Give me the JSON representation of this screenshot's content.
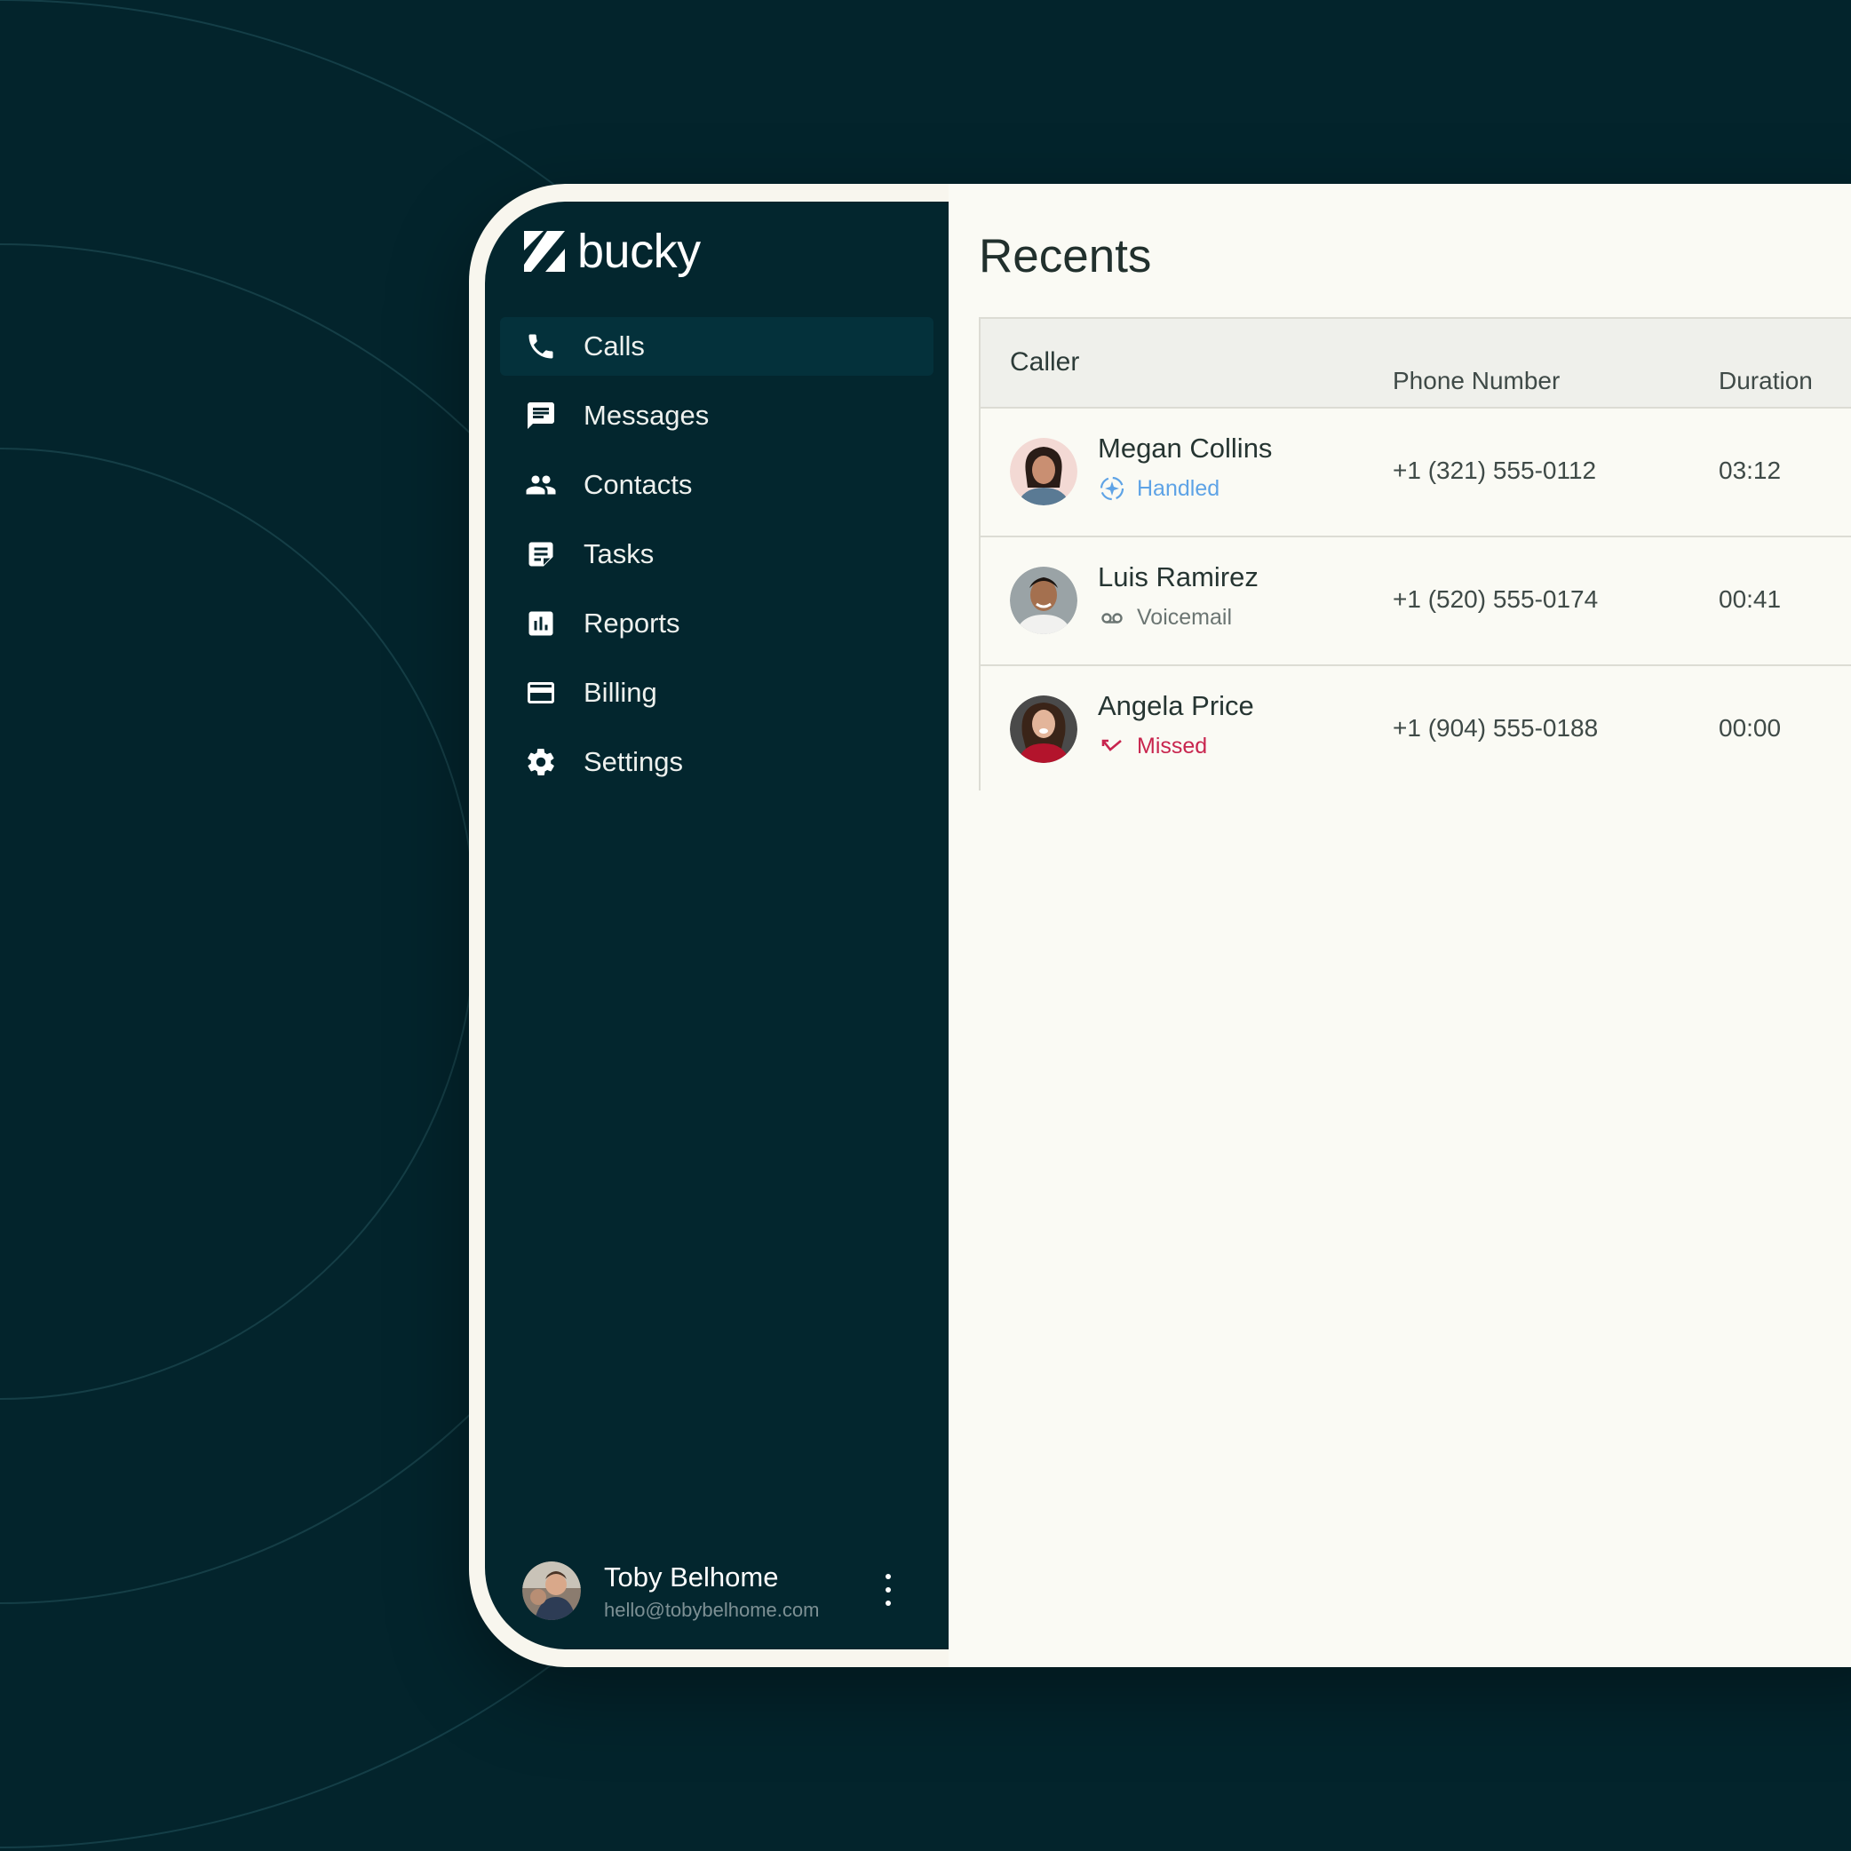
{
  "brand": {
    "name": "bucky"
  },
  "nav": {
    "items": [
      {
        "label": "Calls",
        "icon": "phone-icon",
        "active": true
      },
      {
        "label": "Messages",
        "icon": "message-icon",
        "active": false
      },
      {
        "label": "Contacts",
        "icon": "people-icon",
        "active": false
      },
      {
        "label": "Tasks",
        "icon": "task-icon",
        "active": false
      },
      {
        "label": "Reports",
        "icon": "bar-chart-icon",
        "active": false
      },
      {
        "label": "Billing",
        "icon": "credit-card-icon",
        "active": false
      },
      {
        "label": "Settings",
        "icon": "gear-icon",
        "active": false
      }
    ]
  },
  "user": {
    "name": "Toby Belhome",
    "email": "hello@tobybelhome.com"
  },
  "page": {
    "title": "Recents"
  },
  "table": {
    "columns": {
      "caller": "Caller",
      "phone": "Phone Number",
      "duration": "Duration"
    },
    "rows": [
      {
        "name": "Megan Collins",
        "status": "Handled",
        "status_icon": "sparkle-handled-icon",
        "status_color": "#5ea3e6",
        "phone": "+1 (321) 555-0112",
        "duration": "03:12"
      },
      {
        "name": "Luis Ramirez",
        "status": "Voicemail",
        "status_icon": "voicemail-icon",
        "status_color": "#6b7572",
        "phone": "+1 (520) 555-0174",
        "duration": "00:41"
      },
      {
        "name": "Angela Price",
        "status": "Missed",
        "status_icon": "missed-call-icon",
        "status_color": "#c8254e",
        "phone": "+1 (904) 555-0188",
        "duration": "00:00"
      }
    ]
  },
  "colors": {
    "background": "#03242c",
    "sidebar": "#03262e",
    "active_nav": "#04313b",
    "main": "#fafaf4",
    "handled": "#5ea3e6",
    "missed": "#c8254e"
  }
}
